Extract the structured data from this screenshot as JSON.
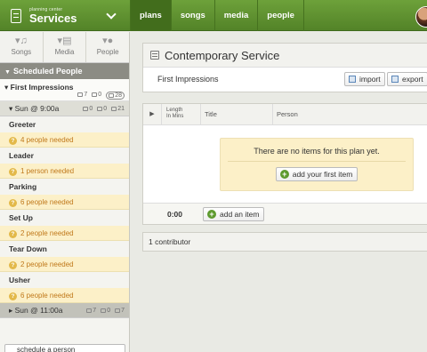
{
  "app": {
    "brand_small": "planning center",
    "brand_name": "Services"
  },
  "nav": {
    "tabs": [
      {
        "label": "plans",
        "active": true
      },
      {
        "label": "songs",
        "active": false
      },
      {
        "label": "media",
        "active": false
      },
      {
        "label": "people",
        "active": false
      }
    ]
  },
  "sidebar": {
    "tools": [
      {
        "label": "Songs",
        "icon": "music-note-icon"
      },
      {
        "label": "Media",
        "icon": "media-icon"
      },
      {
        "label": "People",
        "icon": "person-icon"
      }
    ],
    "header": "Scheduled People",
    "group": {
      "name": "First Impressions",
      "confirmed": "7",
      "declined": "0",
      "total": "28"
    },
    "time1": {
      "label": "Sun @ 9:00a",
      "confirmed": "0",
      "declined": "0",
      "total": "21"
    },
    "positions": [
      {
        "name": "Greeter",
        "needed": "4 people needed"
      },
      {
        "name": "Leader",
        "needed": "1 person needed"
      },
      {
        "name": "Parking",
        "needed": "6 people needed"
      },
      {
        "name": "Set Up",
        "needed": "2 people needed"
      },
      {
        "name": "Tear Down",
        "needed": "2 people needed"
      },
      {
        "name": "Usher",
        "needed": "6 people needed"
      }
    ],
    "time2": {
      "label": "Sun @ 11:00a",
      "confirmed": "7",
      "declined": "0",
      "total": "7"
    },
    "schedule_input_value": "schedule a person"
  },
  "plan": {
    "title": "Contemporary Service",
    "subtitle": "First Impressions",
    "import_label": "import",
    "export_label": "export"
  },
  "items_table": {
    "col_length_line1": "Length",
    "col_length_line2": "In Mins",
    "col_title": "Title",
    "col_person": "Person",
    "empty_message": "There are no items for this plan yet.",
    "add_first_label": "add your first item",
    "total_time": "0:00",
    "add_item_label": "add an item"
  },
  "contributors": "1 contributor",
  "colors": {
    "nav_green": "#538328",
    "needed_bg": "#fcf0c8",
    "needed_text": "#c0781a"
  }
}
